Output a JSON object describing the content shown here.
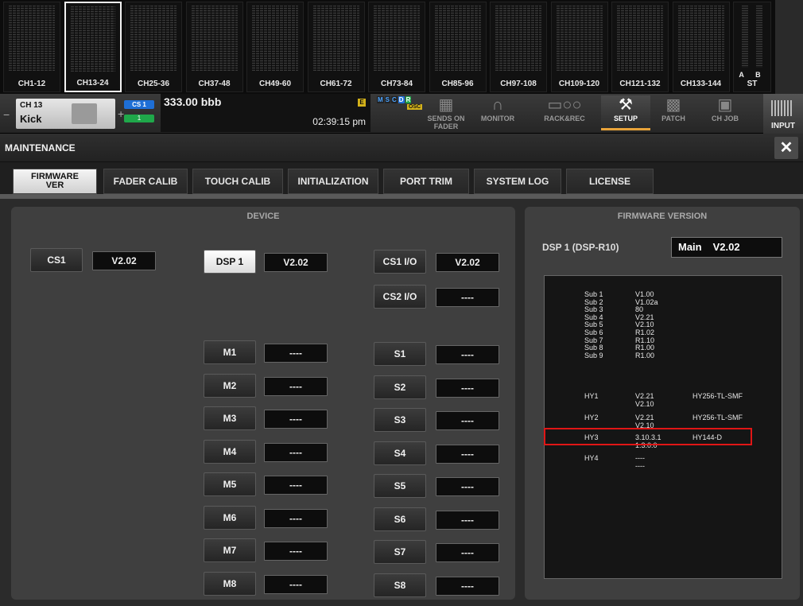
{
  "banks": [
    {
      "label": "CH1-12",
      "selected": false
    },
    {
      "label": "CH13-24",
      "selected": true
    },
    {
      "label": "CH25-36",
      "selected": false
    },
    {
      "label": "CH37-48",
      "selected": false
    },
    {
      "label": "CH49-60",
      "selected": false
    },
    {
      "label": "CH61-72",
      "selected": false
    },
    {
      "label": "CH73-84",
      "selected": false
    },
    {
      "label": "CH85-96",
      "selected": false
    },
    {
      "label": "CH97-108",
      "selected": false
    },
    {
      "label": "CH109-120",
      "selected": false
    },
    {
      "label": "CH121-132",
      "selected": false
    },
    {
      "label": "CH133-144",
      "selected": false
    }
  ],
  "bank_ab": {
    "ab": "A B",
    "st": "ST"
  },
  "channel": {
    "number": "CH 13",
    "name": "Kick"
  },
  "badges": {
    "cs": "CS 1",
    "green": "1"
  },
  "scene": {
    "name": "333.00 bbb",
    "time": "02:39:15 pm",
    "e": "E"
  },
  "status": {
    "m": "M",
    "s": "S",
    "c": "C",
    "d": "D",
    "r": "R",
    "osc": "OSC"
  },
  "func_buttons": [
    {
      "label": "SENDS ON\nFADER",
      "icon": "sends-on-fader-icon"
    },
    {
      "label": "MONITOR",
      "icon": "headphones-icon"
    },
    {
      "label": "RACK&REC",
      "icon": "rack-rec-icon"
    },
    {
      "label": "SETUP",
      "icon": "tools-icon"
    },
    {
      "label": "PATCH",
      "icon": "patch-icon"
    },
    {
      "label": "CH JOB",
      "icon": "toolbox-icon"
    }
  ],
  "input_label": "INPUT",
  "window": {
    "title": "MAINTENANCE",
    "close": "✕"
  },
  "tabs": [
    {
      "label": "FIRMWARE VER",
      "selected": true
    },
    {
      "label": "FADER CALIB",
      "selected": false
    },
    {
      "label": "TOUCH CALIB",
      "selected": false
    },
    {
      "label": "INITIALIZATION",
      "selected": false
    },
    {
      "label": "PORT TRIM",
      "selected": false
    },
    {
      "label": "SYSTEM LOG",
      "selected": false
    },
    {
      "label": "LICENSE",
      "selected": false
    }
  ],
  "device": {
    "header": "DEVICE",
    "cs1": {
      "label": "CS1",
      "value": "V2.02"
    },
    "dsp1": {
      "label": "DSP 1",
      "value": "V2.02",
      "selected": true
    },
    "cs1io": {
      "label": "CS1 I/O",
      "value": "V2.02"
    },
    "cs2io": {
      "label": "CS2 I/O",
      "value": "----"
    },
    "m": [
      {
        "label": "M1",
        "value": "----"
      },
      {
        "label": "M2",
        "value": "----"
      },
      {
        "label": "M3",
        "value": "----"
      },
      {
        "label": "M4",
        "value": "----"
      },
      {
        "label": "M5",
        "value": "----"
      },
      {
        "label": "M6",
        "value": "----"
      },
      {
        "label": "M7",
        "value": "----"
      },
      {
        "label": "M8",
        "value": "----"
      }
    ],
    "s": [
      {
        "label": "S1",
        "value": "----"
      },
      {
        "label": "S2",
        "value": "----"
      },
      {
        "label": "S3",
        "value": "----"
      },
      {
        "label": "S4",
        "value": "----"
      },
      {
        "label": "S5",
        "value": "----"
      },
      {
        "label": "S6",
        "value": "----"
      },
      {
        "label": "S7",
        "value": "----"
      },
      {
        "label": "S8",
        "value": "----"
      }
    ]
  },
  "firmware": {
    "header": "FIRMWARE VERSION",
    "title": "DSP 1 (DSP-R10)",
    "main_label": "Main",
    "main_value": "V2.02",
    "subs": [
      {
        "name": "Sub 1",
        "version": "V1.00"
      },
      {
        "name": "Sub 2",
        "version": "V1.02a"
      },
      {
        "name": "Sub 3",
        "version": "80"
      },
      {
        "name": "Sub 4",
        "version": "V2.21"
      },
      {
        "name": "Sub 5",
        "version": "V2.10"
      },
      {
        "name": "Sub 6",
        "version": "R1.02"
      },
      {
        "name": "Sub 7",
        "version": "R1.10"
      },
      {
        "name": "Sub 8",
        "version": "R1.00"
      },
      {
        "name": "Sub 9",
        "version": "R1.00"
      }
    ],
    "hy": [
      {
        "name": "HY1",
        "v1": "V2.21",
        "v2": "V2.10",
        "model": "HY256-TL-SMF"
      },
      {
        "name": "HY2",
        "v1": "V2.21",
        "v2": "V2.10",
        "model": "HY256-TL-SMF"
      },
      {
        "name": "HY3",
        "v1": "3.10.3.1",
        "v2": "1.3.0.0",
        "model": "HY144-D"
      },
      {
        "name": "HY4",
        "v1": "----",
        "v2": "----",
        "model": ""
      }
    ]
  }
}
